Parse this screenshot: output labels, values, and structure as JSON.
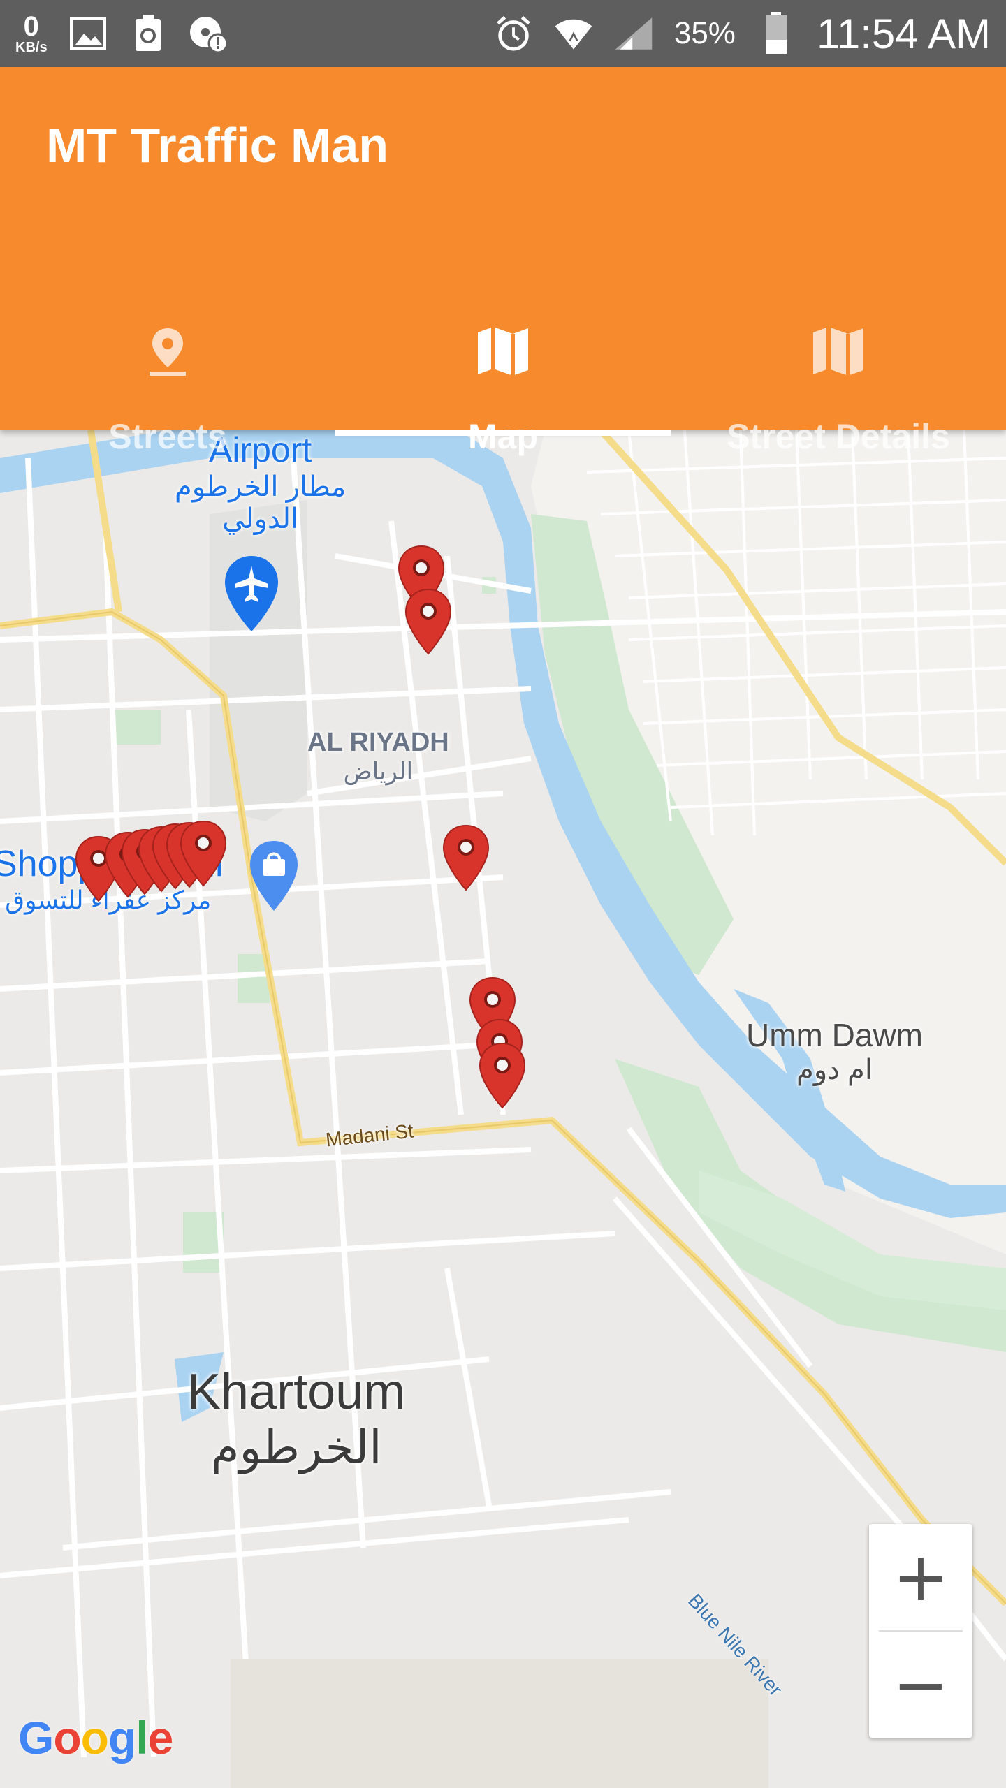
{
  "status_bar": {
    "net_speed_value": "0",
    "net_speed_unit": "KB/s",
    "battery_percent": "35%",
    "time": "11:54 AM",
    "icons": [
      "image-icon",
      "recycle-battery-icon",
      "sd-alert-icon",
      "alarm-icon",
      "wifi-icon",
      "signal-icon",
      "battery-icon"
    ]
  },
  "app": {
    "title": "MT Traffic Man",
    "accent_color": "#f68a2d",
    "tabs": [
      {
        "label": "Streets",
        "icon": "location-pin-icon",
        "active": false
      },
      {
        "label": "Map",
        "icon": "map-icon",
        "active": true
      },
      {
        "label": "Street Details",
        "icon": "map-icon",
        "active": false
      }
    ]
  },
  "map": {
    "labels": {
      "airport_en": "Airport",
      "airport_ar_1": "مطار الخرطوم",
      "airport_ar_2": "الدولي",
      "riyadh_en": "AL RIYADH",
      "riyadh_ar": "الرياض",
      "mall_en": "Shopping Mall",
      "mall_ar": "مركز عفراء للتسوق",
      "umm_dawm_en": "Umm Dawm",
      "umm_dawm_ar": "ام دوم",
      "khartoum_en": "Khartoum",
      "khartoum_ar": "الخرطوم",
      "madani_st": "Madani St",
      "blue_nile": "Blue Nile River"
    },
    "marker_color": "#d9342b",
    "marker_count": 13,
    "zoom_in_label": "+",
    "zoom_out_label": "−",
    "attribution": [
      "G",
      "o",
      "o",
      "g",
      "l",
      "e"
    ]
  }
}
